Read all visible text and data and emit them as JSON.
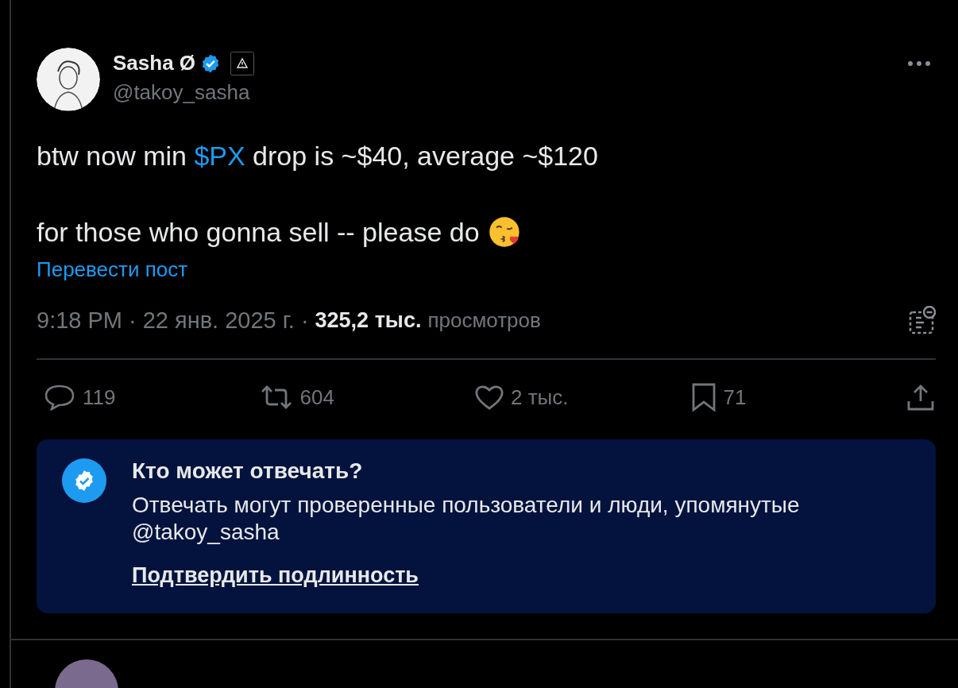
{
  "author": {
    "name": "Sasha Ø",
    "handle": "@takoy_sasha",
    "verified": true
  },
  "post": {
    "lines": [
      {
        "parts": [
          {
            "text": "btw now min ",
            "kind": "plain"
          },
          {
            "text": "$PX",
            "kind": "cashtag"
          },
          {
            "text": " drop is ~$40, average ~$120",
            "kind": "plain"
          }
        ],
        "emoji": false
      },
      {
        "parts": [
          {
            "text": "for those who gonna sell -- please do",
            "kind": "plain"
          }
        ],
        "emoji": true
      }
    ],
    "translate": "Перевести пост"
  },
  "meta": {
    "separator": "·",
    "time": "9:18 PM",
    "date": "22 янв. 2025 г.",
    "views_count": "325,2 тыс.",
    "views_label": "просмотров"
  },
  "actions": [
    {
      "kind": "reply",
      "count": "119"
    },
    {
      "kind": "repost",
      "count": "604"
    },
    {
      "kind": "like",
      "count": "2 тыс."
    },
    {
      "kind": "bookmark",
      "count": "71"
    },
    {
      "kind": "share"
    }
  ],
  "reply_notice": {
    "title": "Кто может отвечать?",
    "text": "Отвечать могут проверенные пользователи и люди, упомянутые @takoy_sasha",
    "link": "Подтвердить подлинность"
  }
}
